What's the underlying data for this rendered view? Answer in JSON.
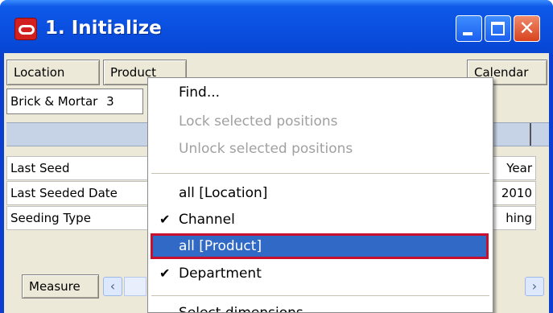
{
  "window": {
    "title": "1. Initialize"
  },
  "toolbar": {
    "location_label": "Location",
    "product_label": "Product",
    "calendar_label": "Calendar"
  },
  "grid": {
    "filter_cell": "Brick & Mortar",
    "filter_cell_suffix": "3",
    "rows": [
      {
        "label": "Last Seed",
        "value": "Year"
      },
      {
        "label": "Last Seeded Date",
        "value": "2010"
      },
      {
        "label": "Seeding Type",
        "value": "hing"
      }
    ]
  },
  "bottom": {
    "measure_label": "Measure"
  },
  "context_menu": {
    "items": [
      {
        "label": "Find...",
        "enabled": true,
        "checked": false
      },
      {
        "label": "Lock selected positions",
        "enabled": false,
        "checked": false
      },
      {
        "label": "Unlock selected positions",
        "enabled": false,
        "checked": false
      },
      {
        "label": "all [Location]",
        "enabled": true,
        "checked": false
      },
      {
        "label": "Channel",
        "enabled": true,
        "checked": true
      },
      {
        "label": "all [Product]",
        "enabled": true,
        "checked": false,
        "selected": true
      },
      {
        "label": "Department",
        "enabled": true,
        "checked": true
      },
      {
        "label": "Select dimensions...",
        "enabled": true,
        "checked": false
      }
    ],
    "check_glyph": "✔"
  },
  "colors": {
    "titlebar": "#0a4fe0",
    "close_button": "#d8431e",
    "selection": "#3169c6",
    "selection_outline": "#c8102e",
    "window_face": "#ece9d8"
  },
  "icons": {
    "app": "oracle-icon",
    "minimize": "minimize-icon",
    "maximize": "maximize-icon",
    "close": "close-icon",
    "scroll_left": "chevron-left-icon",
    "scroll_right": "chevron-right-icon"
  }
}
